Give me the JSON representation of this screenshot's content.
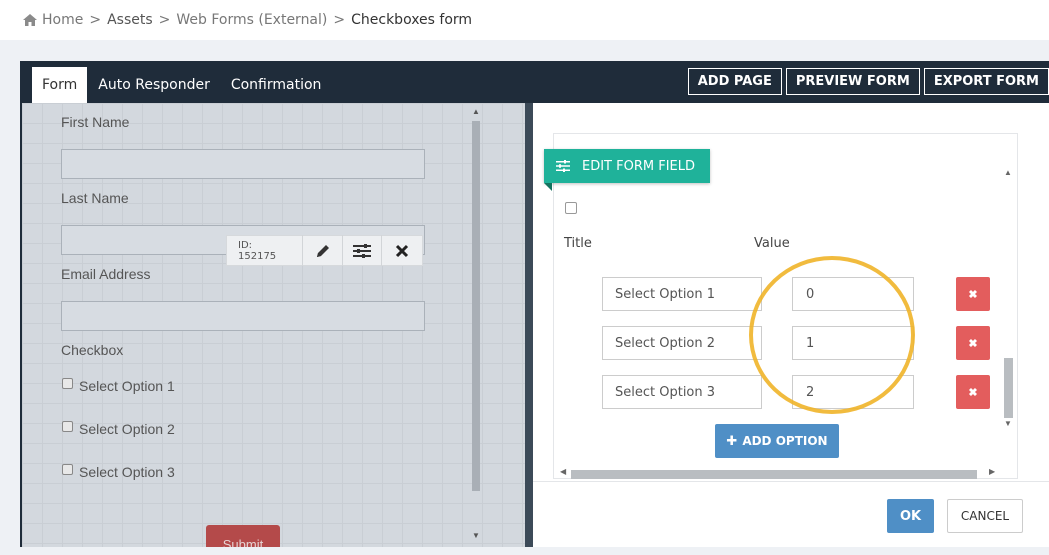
{
  "breadcrumb": {
    "items": [
      "Home",
      "Assets",
      "Web Forms (External)",
      "Checkboxes form"
    ],
    "separator": ">"
  },
  "tabs": [
    {
      "label": "Form",
      "active": true
    },
    {
      "label": "Auto Responder",
      "active": false
    },
    {
      "label": "Confirmation",
      "active": false
    }
  ],
  "top_actions": {
    "add_page": "ADD PAGE",
    "preview_form": "PREVIEW FORM",
    "export_form": "EXPORT FORM"
  },
  "preview": {
    "first_name_label": "First Name",
    "last_name_label": "Last Name",
    "email_label": "Email Address",
    "checkbox_label": "Checkbox",
    "options": [
      "Select Option 1",
      "Select Option 2",
      "Select Option 3"
    ],
    "submit_label": "Submit",
    "field_toolbar": {
      "id_label": "ID: 152175",
      "icons": [
        "pencil-icon",
        "sliders-icon",
        "close-icon"
      ]
    }
  },
  "modal": {
    "header_label": "EDIT FORM FIELD",
    "header_icon": "sliders-icon",
    "columns": {
      "title": "Title",
      "value": "Value"
    },
    "options": [
      {
        "title": "Select Option 1",
        "value": "0"
      },
      {
        "title": "Select Option 2",
        "value": "1"
      },
      {
        "title": "Select Option 3",
        "value": "2"
      }
    ],
    "add_option_label": "ADD OPTION",
    "ok_label": "OK",
    "cancel_label": "CANCEL"
  },
  "colors": {
    "dark_bar": "#1f2c3a",
    "teal": "#1fb29a",
    "blue": "#4f8fc6",
    "delete_red": "#e35d5d",
    "highlight": "#f0b429"
  }
}
